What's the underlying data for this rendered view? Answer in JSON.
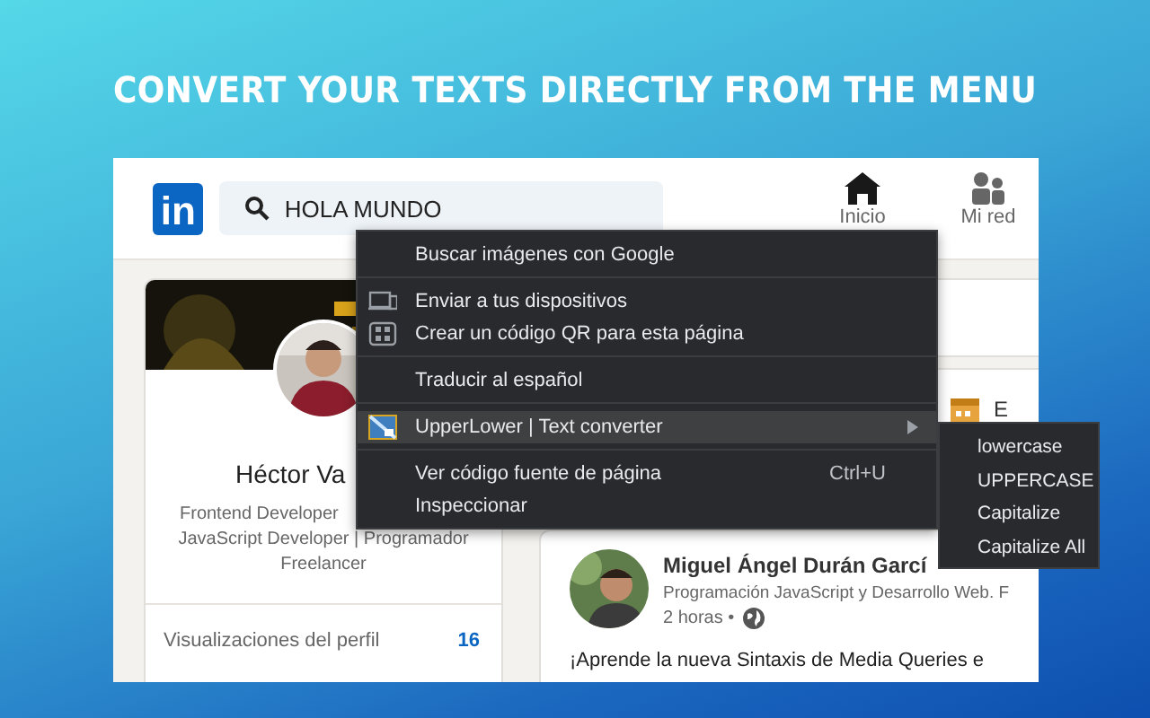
{
  "headline": "CONVERT YOUR TEXTS DIRECTLY FROM THE MENU",
  "header": {
    "logo": "in",
    "search": {
      "value": "HOLA MUNDO"
    },
    "nav": [
      {
        "kind": "home",
        "label": "Inicio"
      },
      {
        "kind": "people",
        "label": "Mi red"
      }
    ]
  },
  "profile_card": {
    "name": "Héctor Va",
    "headline_lines": [
      "Frontend Developer",
      "JavaScript Developer | Programador",
      "Freelancer"
    ],
    "stat": {
      "label": "Visualizaciones del perfil",
      "value": "16"
    }
  },
  "event_card": {
    "text": "E"
  },
  "post": {
    "author": "Miguel Ángel Durán Garcí",
    "subtitle": "Programación JavaScript y Desarrollo Web. F",
    "time": "2 horas •",
    "body": "¡Aprende la nueva Sintaxis de Media Queries e"
  },
  "context_menu": {
    "groups": [
      [
        {
          "label": "Buscar imágenes con Google",
          "kind": "plain",
          "selected": false
        }
      ],
      [
        {
          "label": "Enviar a tus dispositivos",
          "kind": "devices",
          "selected": false
        },
        {
          "label": "Crear un código QR para esta página",
          "kind": "qr",
          "selected": false
        }
      ],
      [
        {
          "label": "Traducir al español",
          "kind": "plain",
          "selected": false
        }
      ],
      [
        {
          "label": "UpperLower | Text converter",
          "kind": "extension",
          "submenu": true,
          "selected": true
        }
      ],
      [
        {
          "label": "Ver código fuente de página",
          "kind": "plain",
          "shortcut": "Ctrl+U",
          "selected": false
        },
        {
          "label": "Inspeccionar",
          "kind": "plain",
          "selected": false
        }
      ]
    ]
  },
  "submenu": {
    "items": [
      {
        "label": "lowercase"
      },
      {
        "label": "UPPERCASE"
      },
      {
        "label": "Capitalize"
      },
      {
        "label": "Capitalize All"
      }
    ]
  }
}
